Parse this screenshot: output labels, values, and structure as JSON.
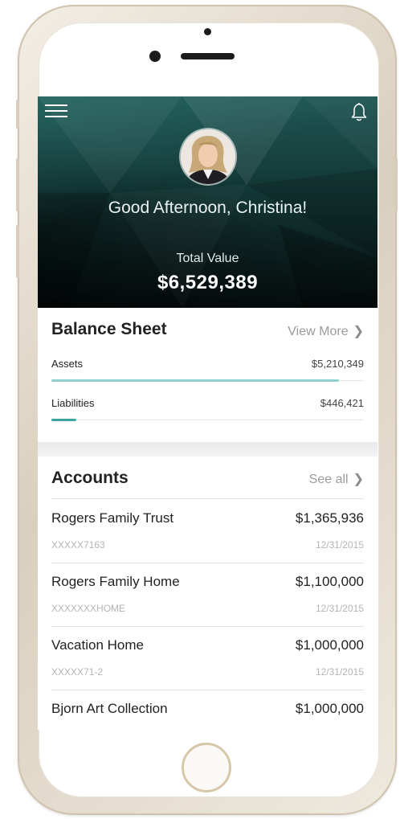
{
  "header": {
    "greeting": "Good Afternoon, Christina!",
    "total_label": "Total Value",
    "total_value": "$6,529,389",
    "menu_icon": "hamburger-menu-icon",
    "bell_icon": "bell-icon"
  },
  "balance_sheet": {
    "title": "Balance Sheet",
    "view_more": "View More",
    "rows": [
      {
        "label": "Assets",
        "value": "$5,210,349",
        "fill": 0.92
      },
      {
        "label": "Liabilities",
        "value": "$446,421",
        "fill": 0.08
      }
    ]
  },
  "accounts": {
    "title": "Accounts",
    "see_all": "See all",
    "items": [
      {
        "name": "Rogers Family Trust",
        "value": "$1,365,936",
        "id": "XXXXX7163",
        "date": "12/31/2015"
      },
      {
        "name": "Rogers Family Home",
        "value": "$1,100,000",
        "id": "XXXXXXXHOME",
        "date": "12/31/2015"
      },
      {
        "name": "Vacation Home",
        "value": "$1,000,000",
        "id": "XXXXX71-2",
        "date": "12/31/2015"
      },
      {
        "name": "Bjorn Art Collection",
        "value": "$1,000,000"
      }
    ]
  },
  "colors": {
    "hero_top": "#1f5653",
    "hero_bottom": "#070f10",
    "accent": "#3ea59e",
    "accent_light": "#8fd0cb"
  }
}
